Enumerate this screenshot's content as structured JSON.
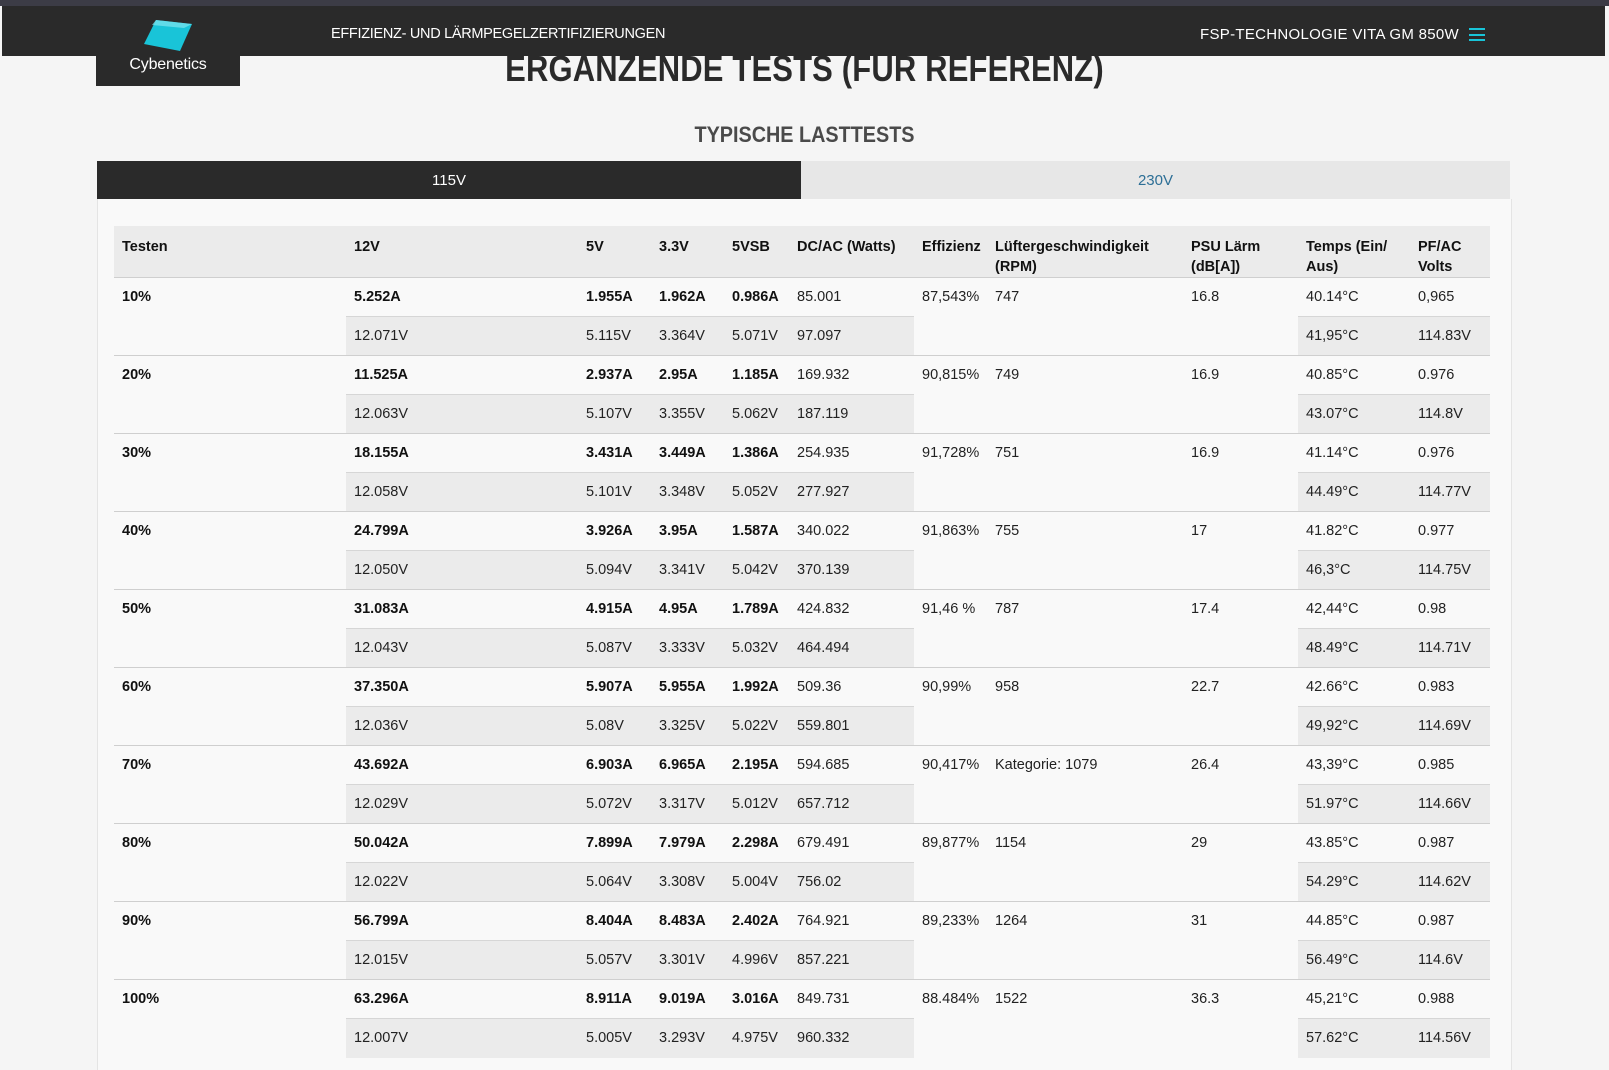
{
  "nav": {
    "logo_text": "Cybenetics",
    "left_link": "EFFIZIENZ- UND LÄRMPEGELZERTIFIZIERUNGEN",
    "right_product": "FSP-TECHNOLOGIE VITA GM 850W",
    "menu_icon": "hamburger-menu-icon",
    "logo_color": "#19c4d8"
  },
  "page_heading": "ERGÄNZENDE TESTS (FÜR REFERENZ)",
  "section_title": "TYPISCHE LASTTESTS",
  "tabs": [
    {
      "label": "115V",
      "active": true
    },
    {
      "label": "230V",
      "active": false
    }
  ],
  "table": {
    "headers": [
      "Testen",
      "12V",
      "5V",
      "3.3V",
      "5VSB",
      "DC/AC (Watts)",
      "Effizienz",
      "Lüftergeschwindigkeit (RPM)",
      "PSU Lärm (dB[A])",
      "Temps (Ein/ Aus)",
      "PF/AC Volts"
    ],
    "rows": [
      {
        "test": "10%",
        "a12": "5.252A",
        "a5": "1.955A",
        "a33": "1.962A",
        "a5vsb": "0.986A",
        "dc": "85.001",
        "eff": "87,543%",
        "fan": "747",
        "noise": "16.8",
        "tin": "40.14°C",
        "pf": "0,965",
        "v12": "12.071V",
        "v5": "5.115V",
        "v33": "3.364V",
        "v5vsb": "5.071V",
        "ac": "97.097",
        "tout": "41,95°C",
        "vac": "114.83V"
      },
      {
        "test": "20%",
        "a12": "11.525A",
        "a5": "2.937A",
        "a33": "2.95A",
        "a5vsb": "1.185A",
        "dc": "169.932",
        "eff": "90,815%",
        "fan": "749",
        "noise": "16.9",
        "tin": "40.85°C",
        "pf": "0.976",
        "v12": "12.063V",
        "v5": "5.107V",
        "v33": "3.355V",
        "v5vsb": "5.062V",
        "ac": "187.119",
        "tout": "43.07°C",
        "vac": "114.8V"
      },
      {
        "test": "30%",
        "a12": "18.155A",
        "a5": "3.431A",
        "a33": "3.449A",
        "a5vsb": "1.386A",
        "dc": "254.935",
        "eff": "91,728%",
        "fan": "751",
        "noise": "16.9",
        "tin": "41.14°C",
        "pf": "0.976",
        "v12": "12.058V",
        "v5": "5.101V",
        "v33": "3.348V",
        "v5vsb": "5.052V",
        "ac": "277.927",
        "tout": "44.49°C",
        "vac": "114.77V"
      },
      {
        "test": "40%",
        "a12": "24.799A",
        "a5": "3.926A",
        "a33": "3.95A",
        "a5vsb": "1.587A",
        "dc": "340.022",
        "eff": "91,863%",
        "fan": "755",
        "noise": "17",
        "tin": "41.82°C",
        "pf": "0.977",
        "v12": "12.050V",
        "v5": "5.094V",
        "v33": "3.341V",
        "v5vsb": "5.042V",
        "ac": "370.139",
        "tout": "46,3°C",
        "vac": "114.75V"
      },
      {
        "test": "50%",
        "a12": "31.083A",
        "a5": "4.915A",
        "a33": "4.95A",
        "a5vsb": "1.789A",
        "dc": "424.832",
        "eff": "91,46 %",
        "fan": "787",
        "noise": "17.4",
        "tin": "42,44°C",
        "pf": "0.98",
        "v12": "12.043V",
        "v5": "5.087V",
        "v33": "3.333V",
        "v5vsb": "5.032V",
        "ac": "464.494",
        "tout": "48.49°C",
        "vac": "114.71V"
      },
      {
        "test": "60%",
        "a12": "37.350A",
        "a5": "5.907A",
        "a33": "5.955A",
        "a5vsb": "1.992A",
        "dc": "509.36",
        "eff": "90,99%",
        "fan": "958",
        "noise": "22.7",
        "tin": "42.66°C",
        "pf": "0.983",
        "v12": "12.036V",
        "v5": "5.08V",
        "v33": "3.325V",
        "v5vsb": "5.022V",
        "ac": "559.801",
        "tout": "49,92°C",
        "vac": "114.69V"
      },
      {
        "test": "70%",
        "a12": "43.692A",
        "a5": "6.903A",
        "a33": "6.965A",
        "a5vsb": "2.195A",
        "dc": "594.685",
        "eff": "90,417%",
        "fan": "Kategorie: 1079",
        "noise": "26.4",
        "tin": "43,39°C",
        "pf": "0.985",
        "v12": "12.029V",
        "v5": "5.072V",
        "v33": "3.317V",
        "v5vsb": "5.012V",
        "ac": "657.712",
        "tout": "51.97°C",
        "vac": "114.66V"
      },
      {
        "test": "80%",
        "a12": "50.042A",
        "a5": "7.899A",
        "a33": "7.979A",
        "a5vsb": "2.298A",
        "dc": "679.491",
        "eff": "89,877%",
        "fan": "1154",
        "noise": "29",
        "tin": "43.85°C",
        "pf": "0.987",
        "v12": "12.022V",
        "v5": "5.064V",
        "v33": "3.308V",
        "v5vsb": "5.004V",
        "ac": "756.02",
        "tout": "54.29°C",
        "vac": "114.62V"
      },
      {
        "test": "90%",
        "a12": "56.799A",
        "a5": "8.404A",
        "a33": "8.483A",
        "a5vsb": "2.402A",
        "dc": "764.921",
        "eff": "89,233%",
        "fan": "1264",
        "noise": "31",
        "tin": "44.85°C",
        "pf": "0.987",
        "v12": "12.015V",
        "v5": "5.057V",
        "v33": "3.301V",
        "v5vsb": "4.996V",
        "ac": "857.221",
        "tout": "56.49°C",
        "vac": "114.6V"
      },
      {
        "test": "100%",
        "a12": "63.296A",
        "a5": "8.911A",
        "a33": "9.019A",
        "a5vsb": "3.016A",
        "dc": "849.731",
        "eff": "88.484%",
        "fan": "1522",
        "noise": "36.3",
        "tin": "45,21°C",
        "pf": "0.988",
        "v12": "12.007V",
        "v5": "5.005V",
        "v33": "3.293V",
        "v5vsb": "4.975V",
        "ac": "960.332",
        "tout": "57.62°C",
        "vac": "114.56V"
      }
    ]
  }
}
